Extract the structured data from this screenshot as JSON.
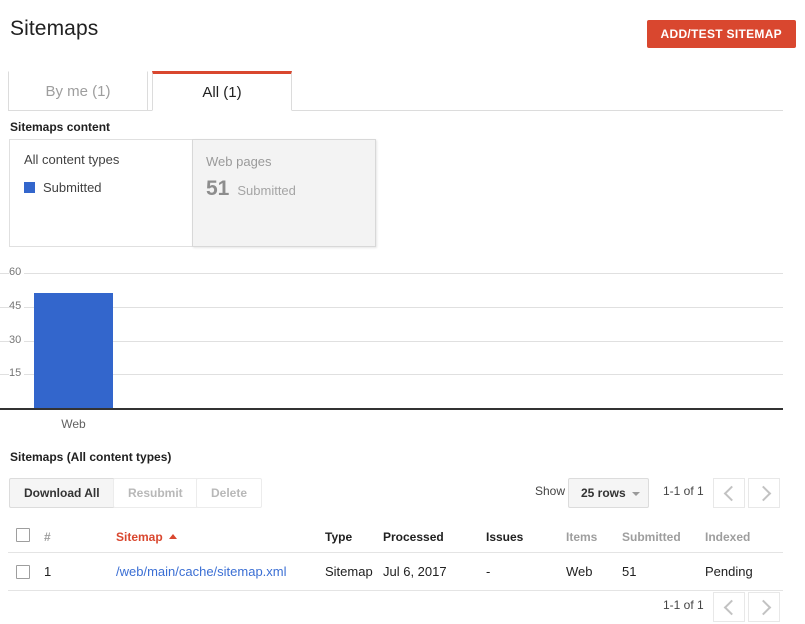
{
  "header": {
    "title": "Sitemaps",
    "add_button": "ADD/TEST SITEMAP"
  },
  "tabs": [
    {
      "label": "By me (1)",
      "active": false
    },
    {
      "label": "All (1)",
      "active": true
    }
  ],
  "content_section": {
    "label": "Sitemaps content",
    "left_card": {
      "title": "All content types",
      "legend": [
        {
          "label": "Submitted",
          "color": "#3366CC"
        }
      ]
    },
    "right_card": {
      "title": "Web pages",
      "value": "51",
      "value_label": "Submitted"
    }
  },
  "chart_data": {
    "type": "bar",
    "title": "",
    "xlabel": "",
    "ylabel": "",
    "categories": [
      "Web"
    ],
    "series": [
      {
        "name": "Submitted",
        "values": [
          51
        ],
        "color": "#3366CC"
      }
    ],
    "ylim": [
      0,
      60
    ],
    "yticks": [
      "15",
      "30",
      "45",
      "60"
    ],
    "ytick_values": [
      15,
      30,
      45,
      60
    ],
    "grid": true,
    "legend_position": "above-left"
  },
  "table_section": {
    "label": "Sitemaps (All content types)",
    "buttons": [
      {
        "label": "Download All",
        "disabled": false
      },
      {
        "label": "Resubmit",
        "disabled": true
      },
      {
        "label": "Delete",
        "disabled": true
      }
    ],
    "show_label": "Show",
    "rows_select": "25 rows",
    "range_top": "1-1 of 1",
    "range_bottom": "1-1 of 1",
    "columns": [
      {
        "label": "#",
        "muted": true,
        "sorted": false
      },
      {
        "label": "Sitemap",
        "muted": false,
        "sorted": true
      },
      {
        "label": "Type",
        "muted": false,
        "sorted": false
      },
      {
        "label": "Processed",
        "muted": false,
        "sorted": false
      },
      {
        "label": "Issues",
        "muted": false,
        "sorted": false
      },
      {
        "label": "Items",
        "muted": true,
        "sorted": false
      },
      {
        "label": "Submitted",
        "muted": true,
        "sorted": false
      },
      {
        "label": "Indexed",
        "muted": true,
        "sorted": false
      }
    ],
    "rows": [
      {
        "num": "1",
        "sitemap": "/web/main/cache/sitemap.xml",
        "type": "Sitemap",
        "processed": "Jul 6, 2017",
        "issues": "-",
        "items": "Web",
        "submitted": "51",
        "indexed": "Pending"
      }
    ]
  },
  "colors": {
    "accent_red": "#D9472F",
    "bar_blue": "#3366CC",
    "link_blue": "#3b6fd4"
  }
}
